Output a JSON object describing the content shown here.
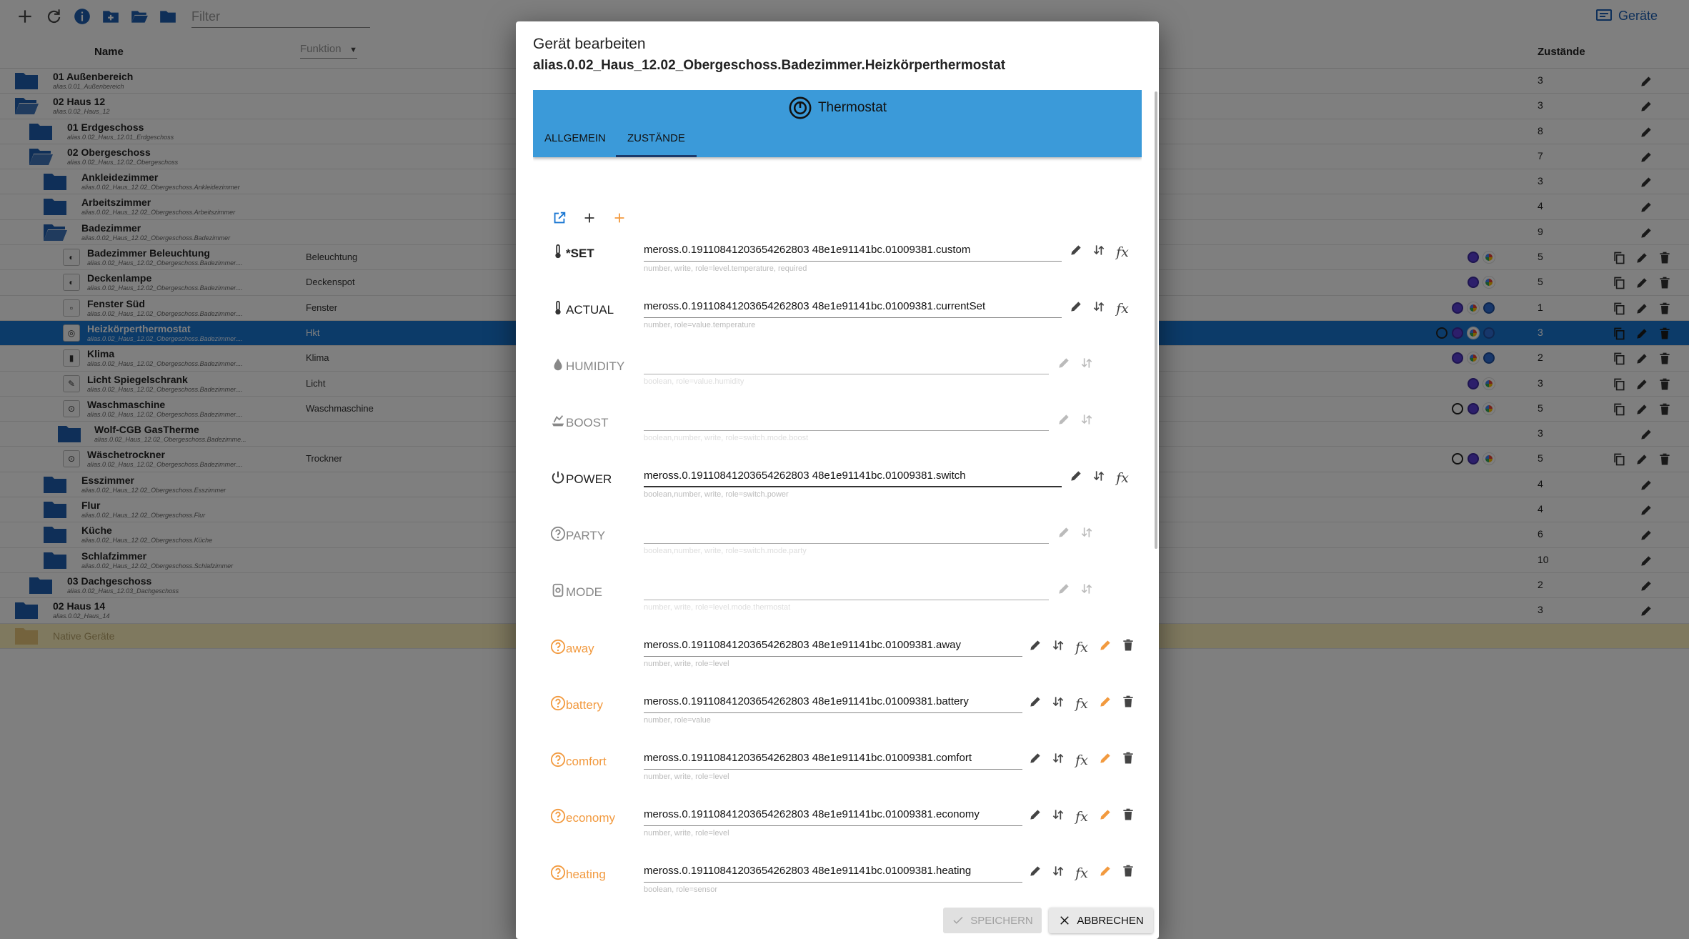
{
  "toolbar": {
    "filter_placeholder": "Filter",
    "devices_label": "Geräte"
  },
  "table": {
    "col_name": "Name",
    "col_function": "Funktion",
    "col_states": "Zustände"
  },
  "rows": [
    {
      "kind": "folder",
      "open": false,
      "indent": 0,
      "name": "01 Außenbereich",
      "sub": "alias.0.01_Außenbereich",
      "func": "",
      "count": "3",
      "icons": [],
      "actions": "edit"
    },
    {
      "kind": "folder",
      "open": true,
      "indent": 0,
      "name": "02 Haus 12",
      "sub": "alias.0.02_Haus_12",
      "func": "",
      "count": "3",
      "icons": [],
      "actions": "edit"
    },
    {
      "kind": "folder",
      "open": false,
      "indent": 1,
      "name": "01 Erdgeschoss",
      "sub": "alias.0.02_Haus_12.01_Erdgeschoss",
      "func": "",
      "count": "8",
      "icons": [],
      "actions": "edit"
    },
    {
      "kind": "folder",
      "open": true,
      "indent": 1,
      "name": "02 Obergeschoss",
      "sub": "alias.0.02_Haus_12.02_Obergeschoss",
      "func": "",
      "count": "7",
      "icons": [],
      "actions": "edit"
    },
    {
      "kind": "folder",
      "open": false,
      "indent": 2,
      "name": "Ankleidezimmer",
      "sub": "alias.0.02_Haus_12.02_Obergeschoss.Ankleidezimmer",
      "func": "",
      "count": "3",
      "icons": [],
      "actions": "edit"
    },
    {
      "kind": "folder",
      "open": false,
      "indent": 2,
      "name": "Arbeitszimmer",
      "sub": "alias.0.02_Haus_12.02_Obergeschoss.Arbeitszimmer",
      "func": "",
      "count": "4",
      "icons": [],
      "actions": "edit"
    },
    {
      "kind": "folder",
      "open": true,
      "indent": 2,
      "name": "Badezimmer",
      "sub": "alias.0.02_Haus_12.02_Obergeschoss.Badezimmer",
      "func": "",
      "count": "9",
      "icons": [],
      "actions": "edit"
    },
    {
      "kind": "device",
      "indent": 3,
      "name": "Badezimmer Beleuchtung",
      "sub": "alias.0.02_Haus_12.02_Obergeschoss.Badezimmer....",
      "func": "Beleuchtung",
      "count": "5",
      "icons": [
        "alexa",
        "google"
      ],
      "actions": "full"
    },
    {
      "kind": "device",
      "indent": 3,
      "name": "Deckenlampe",
      "sub": "alias.0.02_Haus_12.02_Obergeschoss.Badezimmer....",
      "func": "Deckenspot",
      "count": "5",
      "icons": [
        "alexa",
        "google"
      ],
      "actions": "full"
    },
    {
      "kind": "device",
      "indent": 3,
      "name": "Fenster Süd",
      "sub": "alias.0.02_Haus_12.02_Obergeschoss.Badezimmer....",
      "func": "Fenster",
      "count": "1",
      "icons": [
        "alexa",
        "google",
        "blue"
      ],
      "actions": "full"
    },
    {
      "kind": "device",
      "indent": 3,
      "selected": true,
      "name": "Heizkörperthermostat",
      "sub": "alias.0.02_Haus_12.02_Obergeschoss.Badezimmer....",
      "func": "Hkt",
      "count": "3",
      "icons": [
        "ring",
        "alexa",
        "google",
        "blue"
      ],
      "actions": "full"
    },
    {
      "kind": "device",
      "indent": 3,
      "name": "Klima",
      "sub": "alias.0.02_Haus_12.02_Obergeschoss.Badezimmer....",
      "func": "Klima",
      "count": "2",
      "icons": [
        "alexa",
        "google",
        "blue"
      ],
      "actions": "full"
    },
    {
      "kind": "device",
      "indent": 3,
      "name": "Licht Spiegelschrank",
      "sub": "alias.0.02_Haus_12.02_Obergeschoss.Badezimmer....",
      "func": "Licht",
      "count": "3",
      "icons": [
        "alexa",
        "google"
      ],
      "actions": "full"
    },
    {
      "kind": "device",
      "indent": 3,
      "name": "Waschmaschine",
      "sub": "alias.0.02_Haus_12.02_Obergeschoss.Badezimmer....",
      "func": "Waschmaschine",
      "count": "5",
      "icons": [
        "ring",
        "alexa",
        "google"
      ],
      "actions": "full"
    },
    {
      "kind": "folder",
      "open": false,
      "indent": 3,
      "name": "Wolf-CGB GasTherme",
      "sub": "alias.0.02_Haus_12.02_Obergeschoss.Badezimme...",
      "func": "",
      "count": "3",
      "icons": [],
      "actions": "edit"
    },
    {
      "kind": "device",
      "indent": 3,
      "name": "Wäschetrockner",
      "sub": "alias.0.02_Haus_12.02_Obergeschoss.Badezimmer....",
      "func": "Trockner",
      "count": "5",
      "icons": [
        "ring",
        "alexa",
        "google"
      ],
      "actions": "full"
    },
    {
      "kind": "folder",
      "open": false,
      "indent": 2,
      "name": "Esszimmer",
      "sub": "alias.0.02_Haus_12.02_Obergeschoss.Esszimmer",
      "func": "",
      "count": "4",
      "icons": [],
      "actions": "edit"
    },
    {
      "kind": "folder",
      "open": false,
      "indent": 2,
      "name": "Flur",
      "sub": "alias.0.02_Haus_12.02_Obergeschoss.Flur",
      "func": "",
      "count": "4",
      "icons": [],
      "actions": "edit"
    },
    {
      "kind": "folder",
      "open": false,
      "indent": 2,
      "name": "Küche",
      "sub": "alias.0.02_Haus_12.02_Obergeschoss.Küche",
      "func": "",
      "count": "6",
      "icons": [],
      "actions": "edit"
    },
    {
      "kind": "folder",
      "open": false,
      "indent": 2,
      "name": "Schlafzimmer",
      "sub": "alias.0.02_Haus_12.02_Obergeschoss.Schlafzimmer",
      "func": "",
      "count": "10",
      "icons": [],
      "actions": "edit"
    },
    {
      "kind": "folder",
      "open": false,
      "indent": 1,
      "name": "03 Dachgeschoss",
      "sub": "alias.0.02_Haus_12.03_Dachgeschoss",
      "func": "",
      "count": "2",
      "icons": [],
      "actions": "edit"
    },
    {
      "kind": "folder",
      "open": false,
      "indent": 0,
      "name": "02 Haus 14",
      "sub": "alias.0.02_Haus_14",
      "func": "",
      "count": "3",
      "icons": [],
      "actions": "edit"
    },
    {
      "kind": "native",
      "indent": 0,
      "name": "Native Geräte",
      "sub": "",
      "func": "",
      "count": "",
      "icons": [],
      "actions": "none"
    }
  ],
  "dialog": {
    "title": "Gerät bearbeiten",
    "subtitle": "alias.0.02_Haus_12.02_Obergeschoss.Badezimmer.Heizkörperthermostat",
    "card_title": "Thermostat",
    "tabs": [
      "ALLGEMEIN",
      "ZUSTÄNDE"
    ],
    "active_tab": 1,
    "save_label": "SPEICHERN",
    "cancel_label": "ABBRECHEN",
    "states": [
      {
        "name": "*SET",
        "style": "req",
        "icon": "thermometer",
        "value": "meross.0.19110841203654262803 48e1e91141bc.01009381.custom",
        "hint": "number, write, role=level.temperature, required",
        "mode": "full"
      },
      {
        "name": "ACTUAL",
        "style": "normal",
        "icon": "thermometer",
        "value": "meross.0.19110841203654262803 48e1e91141bc.01009381.currentSet",
        "hint": "number, role=value.temperature",
        "mode": "full"
      },
      {
        "name": "HUMIDITY",
        "style": "dim",
        "icon": "drop",
        "value": "",
        "hint": "boolean, role=value.humidity",
        "mode": "empty"
      },
      {
        "name": "BOOST",
        "style": "dim",
        "icon": "boost",
        "value": "",
        "hint": "boolean,number, write, role=switch.mode.boost",
        "mode": "empty"
      },
      {
        "name": "POWER",
        "style": "normal",
        "icon": "power",
        "value": "meross.0.19110841203654262803 48e1e91141bc.01009381.switch",
        "hint": "boolean,number, write, role=switch.power",
        "mode": "full",
        "active": true
      },
      {
        "name": "PARTY",
        "style": "dim",
        "icon": "question",
        "value": "",
        "hint": "boolean,number, write, role=switch.mode.party",
        "mode": "empty"
      },
      {
        "name": "MODE",
        "style": "dim",
        "icon": "mode",
        "value": "",
        "hint": "number, write, role=level.mode.thermostat",
        "mode": "empty"
      },
      {
        "name": "away",
        "style": "orange",
        "icon": "question",
        "value": "meross.0.19110841203654262803 48e1e91141bc.01009381.away",
        "hint": "number, write, role=level",
        "mode": "custom"
      },
      {
        "name": "battery",
        "style": "orange",
        "icon": "question",
        "value": "meross.0.19110841203654262803 48e1e91141bc.01009381.battery",
        "hint": "number, role=value",
        "mode": "custom"
      },
      {
        "name": "comfort",
        "style": "orange",
        "icon": "question",
        "value": "meross.0.19110841203654262803 48e1e91141bc.01009381.comfort",
        "hint": "number, write, role=level",
        "mode": "custom"
      },
      {
        "name": "economy",
        "style": "orange",
        "icon": "question",
        "value": "meross.0.19110841203654262803 48e1e91141bc.01009381.economy",
        "hint": "number, write, role=level",
        "mode": "custom"
      },
      {
        "name": "heating",
        "style": "orange",
        "icon": "question",
        "value": "meross.0.19110841203654262803 48e1e91141bc.01009381.heating",
        "hint": "boolean, role=sensor",
        "mode": "custom"
      }
    ]
  },
  "colors": {
    "accent": "#3b9ad9",
    "folder": "#1e5fb0",
    "selected_row": "#1976d2",
    "custom_state": "#f29a3f",
    "native_row": "#fff3bf"
  }
}
